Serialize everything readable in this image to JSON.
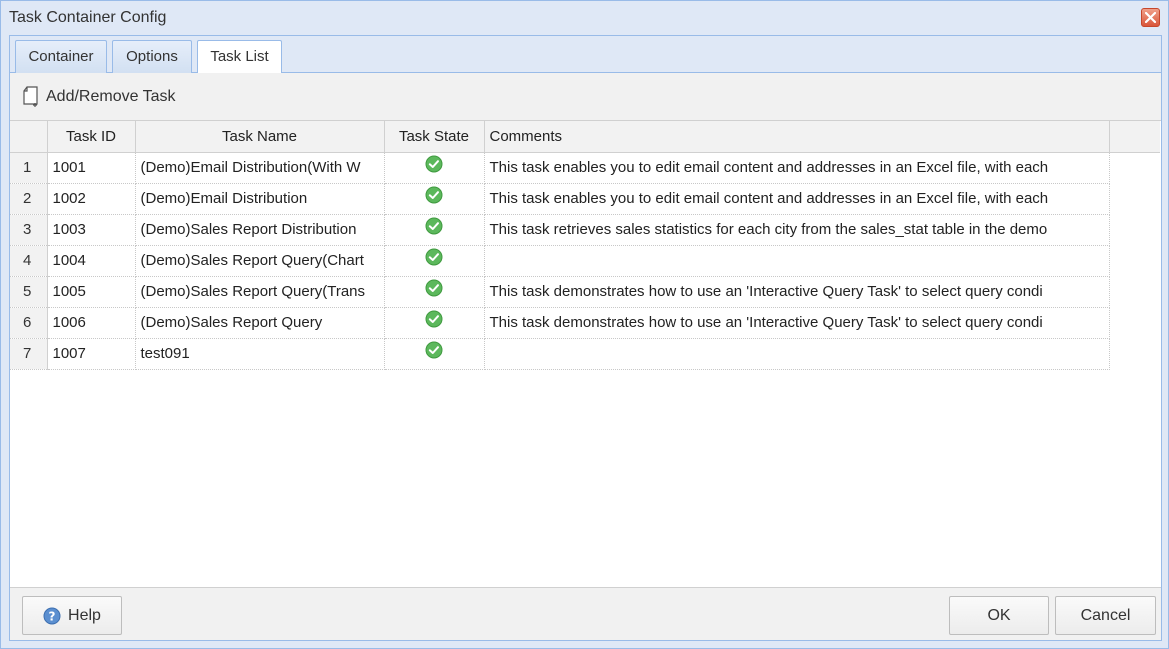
{
  "window": {
    "title": "Task Container Config"
  },
  "tabs": [
    {
      "label": "Container"
    },
    {
      "label": "Options"
    },
    {
      "label": "Task List",
      "active": true
    }
  ],
  "toolbar": {
    "add_remove_label": "Add/Remove Task",
    "icon": "new-document-icon"
  },
  "table": {
    "columns": [
      "Task ID",
      "Task Name",
      "Task State",
      "Comments"
    ],
    "rows": [
      {
        "num": "1",
        "id": "1001",
        "name": "(Demo)Email Distribution(With W",
        "state": "ok",
        "comment": "This task enables you to edit email content and addresses in an Excel file, with each"
      },
      {
        "num": "2",
        "id": "1002",
        "name": "(Demo)Email Distribution",
        "state": "ok",
        "comment": "This task enables you to edit email content and addresses in an Excel file, with each"
      },
      {
        "num": "3",
        "id": "1003",
        "name": "(Demo)Sales Report Distribution",
        "state": "ok",
        "comment": "This task retrieves sales statistics for each city from the sales_stat table in the demo"
      },
      {
        "num": "4",
        "id": "1004",
        "name": "(Demo)Sales Report Query(Chart",
        "state": "ok",
        "comment": ""
      },
      {
        "num": "5",
        "id": "1005",
        "name": "(Demo)Sales Report Query(Trans",
        "state": "ok",
        "comment": "This task demonstrates how to use an 'Interactive Query Task' to select query condi"
      },
      {
        "num": "6",
        "id": "1006",
        "name": "(Demo)Sales Report Query",
        "state": "ok",
        "comment": "This task demonstrates how to use an 'Interactive Query Task' to select query condi"
      },
      {
        "num": "7",
        "id": "1007",
        "name": "test091",
        "state": "ok",
        "comment": ""
      }
    ]
  },
  "footer": {
    "help_label": "Help",
    "ok_label": "OK",
    "cancel_label": "Cancel"
  },
  "colors": {
    "accent": "#99bbe8",
    "check_green": "#5cb85c",
    "close_red": "#d9563a"
  }
}
